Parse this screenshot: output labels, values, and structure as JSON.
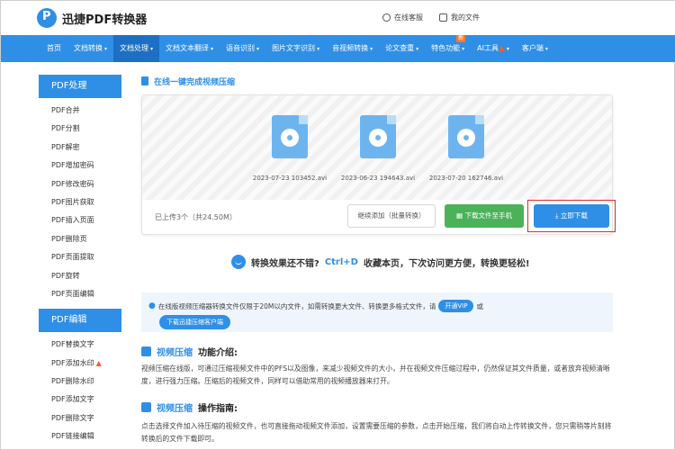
{
  "header": {
    "logo_text": "迅捷PDF转换器",
    "customer_service": "在线客服",
    "my_files": "我的文件"
  },
  "nav": {
    "items": [
      {
        "label": "首页",
        "caret": ""
      },
      {
        "label": "文档转换",
        "caret": "▾"
      },
      {
        "label": "文档处理",
        "caret": "▾"
      },
      {
        "label": "文档文本翻译",
        "caret": "▾"
      },
      {
        "label": "语音识别",
        "caret": "▾"
      },
      {
        "label": "图片文字识别",
        "caret": "▾"
      },
      {
        "label": "音视频转换",
        "caret": "▾"
      },
      {
        "label": "论文查重",
        "caret": "▾"
      },
      {
        "label": "特色功能",
        "caret": "▾"
      },
      {
        "label": "AI工具",
        "caret": "▾"
      },
      {
        "label": "客户端",
        "caret": "▾"
      }
    ],
    "new_badge": "新"
  },
  "sidebar": {
    "group1_title": "PDF处理",
    "group1_items": [
      "PDF合并",
      "PDF分割",
      "PDF解密",
      "PDF增加密码",
      "PDF修改密码",
      "PDF图片获取",
      "PDF插入页面",
      "PDF删除页",
      "PDF页面提取",
      "PDF旋转",
      "PDF页面编辑"
    ],
    "group2_title": "PDF编辑",
    "group2_items": [
      "PDF替换文字",
      "PDF添加水印",
      "PDF删除水印",
      "PDF添加文字",
      "PDF删除文字",
      "PDF链接编辑"
    ]
  },
  "main": {
    "section_title": "在线一键完成视频压缩",
    "files": [
      "2023-07-23 103452.avi",
      "2023-06-23 194643.avi",
      "2023-07-20 162746.avi"
    ],
    "upload_info": "已上传3个（共24.50M）",
    "continue_button": "继续添加（批量转换）",
    "download_phone_button": "下载文件至手机",
    "download_button": "立即下载",
    "promo_prefix": "转换效果还不错?",
    "promo_hotkey": "Ctrl+D",
    "promo_suffix": "收藏本页，下次访问更方便，转换更轻松!",
    "notice_text": "在线版视频压缩器转换文件仅限于20M以内文件，如需转换更大文件、转换更多格式文件，请",
    "notice_vip": "开通VIP",
    "notice_or": "或",
    "notice_client": "下载迅捷压缩客户端",
    "intro_title_blue": "视频压缩",
    "intro_title_rest": "功能介绍:",
    "intro_text": "视频压缩在线版，可通过压缩视频文件中的PFS以及图像，来减少视频文件的大小，并在视频文件压缩过程中，仍然保证其文件质量，或者放弃视频清晰度，进行强力压缩。压缩后的视频文件，同样可以借助常用的视频播放器来打开。",
    "guide_title_blue": "视频压缩",
    "guide_title_rest": "操作指南:",
    "guide_text": "点击选择文件加入待压缩的视频文件，也可直接拖动视频文件添加，设置需要压缩的参数，点击开始压缩，我们将自动上传转换文件，您只需稍等片刻将转换后的文件下载即可。"
  },
  "colors": {
    "brand_blue": "#2f8fe6",
    "green": "#4cb25a",
    "highlight_red": "#e02b2b"
  }
}
